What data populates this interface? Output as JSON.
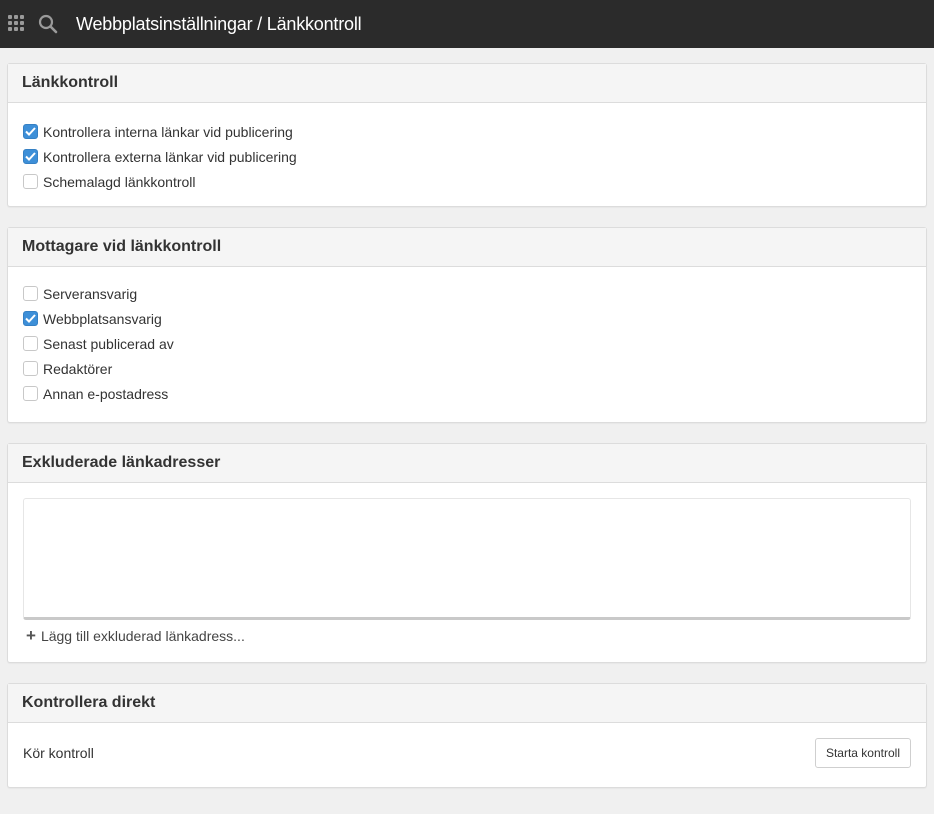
{
  "topbar": {
    "title": "Webbplatsinställningar / Länkkontroll"
  },
  "link_check": {
    "title": "Länkkontroll",
    "options": [
      {
        "label": "Kontrollera interna länkar vid publicering",
        "checked": true
      },
      {
        "label": "Kontrollera externa länkar vid publicering",
        "checked": true
      },
      {
        "label": "Schemalagd länkkontroll",
        "checked": false
      }
    ]
  },
  "recipients": {
    "title": "Mottagare vid länkkontroll",
    "options": [
      {
        "label": "Serveransvarig",
        "checked": false
      },
      {
        "label": "Webbplatsansvarig",
        "checked": true
      },
      {
        "label": "Senast publicerad av",
        "checked": false
      },
      {
        "label": "Redaktörer",
        "checked": false
      },
      {
        "label": "Annan e-postadress",
        "checked": false
      }
    ]
  },
  "excluded": {
    "title": "Exkluderade länkadresser",
    "add_label": "Lägg till exkluderad länkadress..."
  },
  "check_now": {
    "title": "Kontrollera direkt",
    "run_label": "Kör kontroll",
    "button_label": "Starta kontroll"
  },
  "colors": {
    "topbar": "#2b2b2b",
    "checkbox_checked": "#3d8fd8"
  }
}
